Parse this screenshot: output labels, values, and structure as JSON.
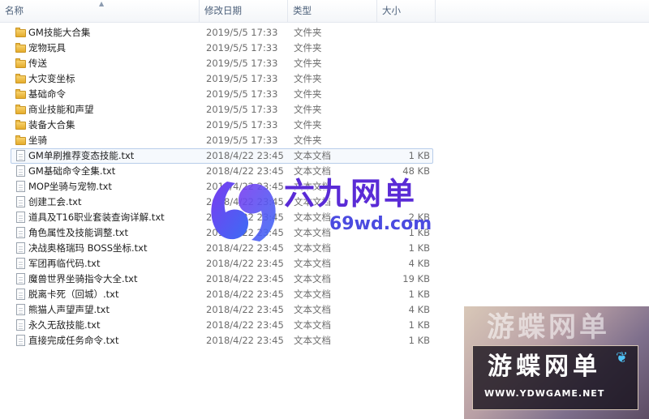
{
  "columns": {
    "name": "名称",
    "date": "修改日期",
    "type": "类型",
    "size": "大小"
  },
  "items": [
    {
      "kind": "folder",
      "name": "GM技能大合集",
      "date": "2019/5/5 17:33",
      "type": "文件夹",
      "size": ""
    },
    {
      "kind": "folder",
      "name": "宠物玩具",
      "date": "2019/5/5 17:33",
      "type": "文件夹",
      "size": ""
    },
    {
      "kind": "folder",
      "name": "传送",
      "date": "2019/5/5 17:33",
      "type": "文件夹",
      "size": ""
    },
    {
      "kind": "folder",
      "name": "大灾变坐标",
      "date": "2019/5/5 17:33",
      "type": "文件夹",
      "size": ""
    },
    {
      "kind": "folder",
      "name": "基础命令",
      "date": "2019/5/5 17:33",
      "type": "文件夹",
      "size": ""
    },
    {
      "kind": "folder",
      "name": "商业技能和声望",
      "date": "2019/5/5 17:33",
      "type": "文件夹",
      "size": ""
    },
    {
      "kind": "folder",
      "name": "装备大合集",
      "date": "2019/5/5 17:33",
      "type": "文件夹",
      "size": ""
    },
    {
      "kind": "folder",
      "name": "坐骑",
      "date": "2019/5/5 17:33",
      "type": "文件夹",
      "size": ""
    },
    {
      "kind": "doc",
      "name": "GM单刷推荐变态技能.txt",
      "date": "2018/4/22 23:45",
      "type": "文本文档",
      "size": "1 KB"
    },
    {
      "kind": "doc",
      "name": "GM基础命令全集.txt",
      "date": "2018/4/22 23:45",
      "type": "文本文档",
      "size": "48 KB"
    },
    {
      "kind": "doc",
      "name": "MOP坐骑与宠物.txt",
      "date": "2018/4/22 23:45",
      "type": "文本文档",
      "size": ""
    },
    {
      "kind": "doc",
      "name": "创建工会.txt",
      "date": "2018/4/22 23:45",
      "type": "文本文档",
      "size": ""
    },
    {
      "kind": "doc",
      "name": "道具及T16职业套装查询详解.txt",
      "date": "2018/4/22 23:45",
      "type": "文本文档",
      "size": "2 KB"
    },
    {
      "kind": "doc",
      "name": "角色属性及技能调整.txt",
      "date": "2018/4/22 23:45",
      "type": "文本文档",
      "size": "1 KB"
    },
    {
      "kind": "doc",
      "name": "决战奥格瑞玛 BOSS坐标.txt",
      "date": "2018/4/22 23:45",
      "type": "文本文档",
      "size": "1 KB"
    },
    {
      "kind": "doc",
      "name": "军团再临代码.txt",
      "date": "2018/4/22 23:45",
      "type": "文本文档",
      "size": "4 KB"
    },
    {
      "kind": "doc",
      "name": "魔兽世界坐骑指令大全.txt",
      "date": "2018/4/22 23:45",
      "type": "文本文档",
      "size": "19 KB"
    },
    {
      "kind": "doc",
      "name": "脱离卡死（回城）.txt",
      "date": "2018/4/22 23:45",
      "type": "文本文档",
      "size": "1 KB"
    },
    {
      "kind": "doc",
      "name": "熊猫人声望声望.txt",
      "date": "2018/4/22 23:45",
      "type": "文本文档",
      "size": "4 KB"
    },
    {
      "kind": "doc",
      "name": "永久无敌技能.txt",
      "date": "2018/4/22 23:45",
      "type": "文本文档",
      "size": "1 KB"
    },
    {
      "kind": "doc",
      "name": "直接完成任务命令.txt",
      "date": "2018/4/22 23:45",
      "type": "文本文档",
      "size": "1 KB"
    }
  ],
  "selected_index": 8,
  "watermark1": {
    "text": "六九网单",
    "url": "69wd.com"
  },
  "watermark2": {
    "ghost": "游蝶网单",
    "title": "游蝶网单",
    "url": "WWW.YDWGAME.NET"
  },
  "colors": {
    "accent": "#5a2bd6",
    "folder": "#e5ac2c",
    "header_text": "#4c607a"
  }
}
